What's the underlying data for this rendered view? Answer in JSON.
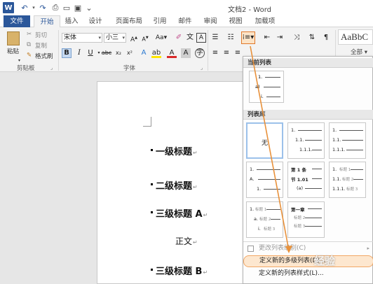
{
  "window": {
    "title": "文档2 - Word"
  },
  "tabs": [
    "文件",
    "开始",
    "插入",
    "设计",
    "页面布局",
    "引用",
    "邮件",
    "审阅",
    "视图",
    "加载项"
  ],
  "clipboard": {
    "paste": "粘贴",
    "cut": "剪切",
    "copy": "复制",
    "format_painter": "格式刷",
    "group_label": "剪贴板"
  },
  "font": {
    "name": "宋体",
    "size": "小三",
    "group_label": "字体"
  },
  "styles": {
    "preview": "AaBbC",
    "all": "全部"
  },
  "document": {
    "lines": [
      {
        "text": "一级标题",
        "ret": "↵"
      },
      {
        "text": "二级标题",
        "ret": "↵"
      },
      {
        "text": "三级标题 A",
        "ret": "↵"
      },
      {
        "text": "正文",
        "ret": "↵"
      },
      {
        "text": "三级标题 B",
        "ret": "↵"
      }
    ]
  },
  "panel": {
    "current_list_header": "当前列表",
    "library_header": "列表库",
    "none_label": "无",
    "current_preview": [
      "1.",
      "a)",
      "i."
    ],
    "lib_levels_a": [
      "1.",
      "1.1.",
      "1.1.1."
    ],
    "lib_levels_b": [
      "1.",
      "1.1.",
      "1.1.1."
    ],
    "lib_levels_c": [
      "1.",
      "A.",
      "1."
    ],
    "lib_levels_d": [
      "第 1 条",
      "节 1.01",
      "(a)"
    ],
    "lib_levels_e": [
      "1.",
      "1.1.",
      "1.1.1."
    ],
    "lib_levels_f": [
      "1.",
      "a.",
      "i."
    ],
    "lib_levels_g": [
      "第一章",
      "1."
    ],
    "heading_tags": [
      "标题 1",
      "标题 2",
      "标题 3"
    ],
    "change_level": "更改列表级别(C)",
    "define_multilevel": "定义新的多级列表(D)...",
    "define_style": "定义新的列表样式(L)..."
  },
  "overlay": {
    "watermark": "经验",
    "arrow_color": "#e8913b"
  }
}
